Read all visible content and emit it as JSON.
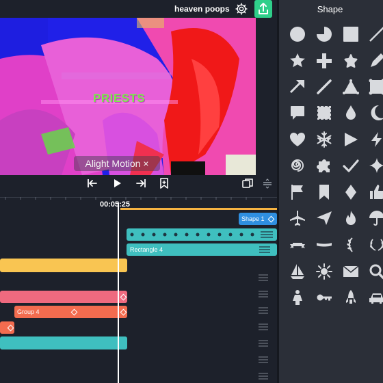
{
  "header": {
    "project_title": "heaven poops",
    "settings_icon": "gear-icon",
    "export_icon": "share-upload-icon"
  },
  "preview": {
    "overlay_text": "PRIESTS",
    "watermark": "Alight Motion ×"
  },
  "transport": {
    "timecode": "00:05:25",
    "buttons": [
      "jump-start-icon",
      "play-icon",
      "jump-end-icon",
      "bookmark-icon"
    ]
  },
  "tracks": {
    "shape_clip_label": "Shape 1",
    "rectangle_clip_label": "Rectangle 4",
    "group_clip_label": "Group 4"
  },
  "shape_panel": {
    "title": "Shape",
    "icons": [
      "circle-icon",
      "pie-icon",
      "square-icon",
      "line-icon",
      "star-icon",
      "plus-icon",
      "rounded-star-icon",
      "pencil-icon",
      "arrow-icon",
      "stroke-icon",
      "triangle-icon",
      "rounded-square-icon",
      "speech-bubble-icon",
      "stamp-icon",
      "drop-icon",
      "crescent-icon",
      "heart-icon",
      "snowflake-icon",
      "play-triangle-icon",
      "lightning-icon",
      "spiral-icon",
      "puzzle-icon",
      "checkmark-icon",
      "sparkle-icon",
      "flag-icon",
      "bookmark-shape-icon",
      "diamond-icon",
      "thumbs-up-icon",
      "airplane-icon",
      "paper-plane-icon",
      "fire-icon",
      "umbrella-icon",
      "banner-icon",
      "ribbon-icon",
      "laurel-left-icon",
      "laurel-icon",
      "sailboat-icon",
      "sun-icon",
      "envelope-icon",
      "magnifier-icon",
      "person-icon",
      "key-icon",
      "rocket-icon",
      "car-icon"
    ]
  },
  "colors": {
    "export": "#2fcf8a",
    "yellow_clip": "#f9c552",
    "pink_clip": "#ef6a7f",
    "orange_clip": "#f36c4f",
    "teal_clip": "#3fbfbf",
    "blue_clip": "#2f8fe0"
  }
}
